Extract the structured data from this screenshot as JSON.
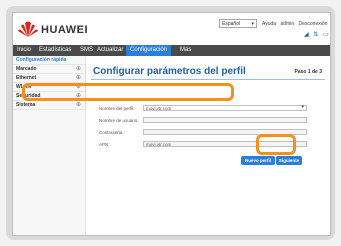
{
  "header": {
    "brand": "HUAWEI",
    "language": "Español",
    "links": [
      "Ayuda",
      "admin",
      "Desconexión"
    ],
    "status_icons": [
      "signal-icon",
      "data-transfer-icon",
      "wifi-icon"
    ]
  },
  "nav": {
    "items": [
      {
        "label": "Inicio",
        "active": false
      },
      {
        "label": "Estadísticas",
        "active": false
      },
      {
        "label": "SMS",
        "active": false
      },
      {
        "label": "Actualizar",
        "active": false
      },
      {
        "label": "Configuración",
        "active": true
      },
      {
        "label": "Más",
        "active": false
      }
    ]
  },
  "sidebar": {
    "items": [
      {
        "label": "Configuración rápida",
        "active": true,
        "expand": ""
      },
      {
        "label": "Marcado",
        "active": false,
        "expand": "⊕"
      },
      {
        "label": "Ethernet",
        "active": false,
        "expand": "⊕"
      },
      {
        "label": "WLAN",
        "active": false,
        "expand": "⊕"
      },
      {
        "label": "Seguridad",
        "active": false,
        "expand": "⊕"
      },
      {
        "label": "Sistema",
        "active": false,
        "expand": "⊕"
      }
    ]
  },
  "main": {
    "title": "Configurar parámetros del perfil",
    "step": "Paso 1 de 3",
    "form": {
      "profile_label": "Nombre del perfil:",
      "profile_value": "movi.vtr.com",
      "user_label": "Nombre de usuario:",
      "user_value": "",
      "password_label": "Contraseña:",
      "password_value": "",
      "apn_label": "APN:",
      "apn_value": "movi.vtr.com"
    },
    "buttons": {
      "new_profile": "Nuevo perfil",
      "next": "Siguiente"
    }
  },
  "colors": {
    "accent": "#2c7fd8",
    "highlight": "#f4901e",
    "title": "#1f5ea8",
    "logo_red": "#e1251b"
  }
}
